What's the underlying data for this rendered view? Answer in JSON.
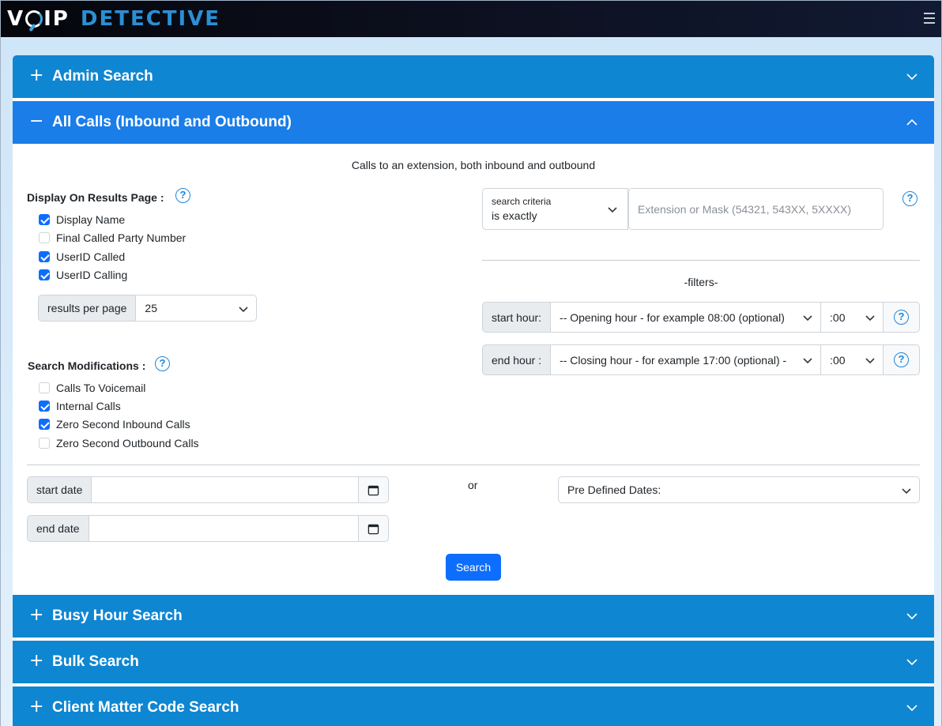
{
  "app": {
    "logo_voip_v": "V",
    "logo_voip_ip": "IP",
    "logo_detective": "DETECTIVE"
  },
  "accordions": {
    "admin": {
      "sign": "+",
      "title": "Admin Search"
    },
    "all_calls": {
      "sign": "−",
      "title": "All Calls (Inbound and Outbound)"
    },
    "busy_hour": {
      "sign": "+",
      "title": "Busy Hour Search"
    },
    "bulk": {
      "sign": "+",
      "title": "Bulk Search"
    },
    "client_matter": {
      "sign": "+",
      "title": "Client Matter Code Search"
    }
  },
  "all_calls": {
    "description": "Calls to an extension, both inbound and outbound",
    "display_label": "Display On Results Page :",
    "display_options": [
      {
        "label": "Display Name",
        "checked": true
      },
      {
        "label": "Final Called Party Number",
        "checked": false
      },
      {
        "label": "UserID Called",
        "checked": true
      },
      {
        "label": "UserID Calling",
        "checked": true
      }
    ],
    "results_per_page_label": "results per page",
    "results_per_page_value": "25",
    "modifications_label": "Search Modifications :",
    "modification_options": [
      {
        "label": "Calls To Voicemail",
        "checked": false
      },
      {
        "label": "Internal Calls",
        "checked": true
      },
      {
        "label": "Zero Second Inbound Calls",
        "checked": true
      },
      {
        "label": "Zero Second Outbound Calls",
        "checked": false
      }
    ],
    "criteria_small_label": "search criteria",
    "criteria_value": "is exactly",
    "extension_placeholder": "Extension or Mask (54321, 543XX, 5XXXX)",
    "filters_label": "-filters-",
    "start_hour_label": "start hour:",
    "start_hour_value": "-- Opening hour - for example 08:00 (optional)",
    "start_minute_value": ":00",
    "end_hour_label": "end hour :",
    "end_hour_value": "-- Closing hour - for example 17:00 (optional) -",
    "end_minute_value": ":00",
    "start_date_label": "start date",
    "end_date_label": "end date",
    "or_label": "or",
    "predefined_dates_value": "Pre Defined Dates:",
    "search_button": "Search",
    "help_glyph": "?"
  },
  "colors": {
    "accordion_closed": "#0f86d1",
    "accordion_open": "#1a7de8",
    "primary_button": "#0d6efd",
    "help_icon": "#1f86d8"
  }
}
